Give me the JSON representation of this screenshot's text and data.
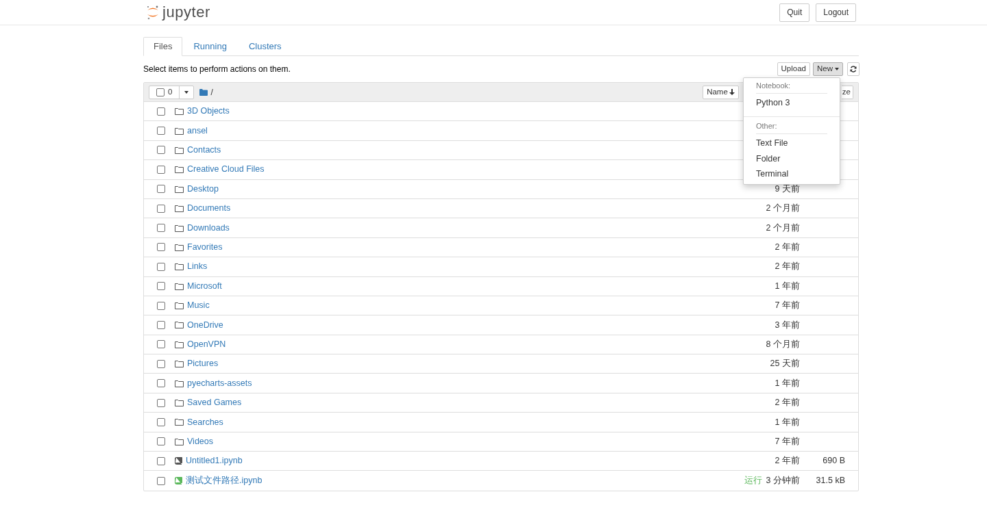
{
  "header": {
    "logo_text": "jupyter",
    "buttons": [
      "Quit",
      "Logout"
    ]
  },
  "tabs": [
    {
      "label": "Files",
      "selected": true
    },
    {
      "label": "Running",
      "selected": false
    },
    {
      "label": "Clusters",
      "selected": false
    }
  ],
  "toolbar": {
    "hint": "Select items to perform actions on them.",
    "buttons": [
      "Upload",
      "New"
    ]
  },
  "list_header": {
    "all_checked": false,
    "selected_count": "0",
    "path": "/",
    "name_column": "Name",
    "size_column": "ze"
  },
  "new_menu": {
    "sections": [
      {
        "heading": "Notebook:",
        "items": [
          "Python 3"
        ]
      },
      {
        "heading": "Other:",
        "items": [
          "Text File",
          "Folder",
          "Terminal"
        ]
      }
    ]
  },
  "rows": [
    {
      "kind": "folder",
      "name": "3D Objects",
      "checked": false
    },
    {
      "kind": "folder",
      "name": "ansel",
      "checked": false
    },
    {
      "kind": "folder",
      "name": "Contacts",
      "checked": false
    },
    {
      "kind": "folder",
      "name": "Creative Cloud Files",
      "checked": false
    },
    {
      "kind": "folder",
      "name": "Desktop",
      "checked": false,
      "modified": "9 天前"
    },
    {
      "kind": "folder",
      "name": "Documents",
      "checked": false,
      "modified": "2 个月前"
    },
    {
      "kind": "folder",
      "name": "Downloads",
      "checked": false,
      "modified": "2 个月前"
    },
    {
      "kind": "folder",
      "name": "Favorites",
      "checked": false,
      "modified": "2 年前"
    },
    {
      "kind": "folder",
      "name": "Links",
      "checked": false,
      "modified": "2 年前"
    },
    {
      "kind": "folder",
      "name": "Microsoft",
      "checked": false,
      "modified": "1 年前"
    },
    {
      "kind": "folder",
      "name": "Music",
      "checked": false,
      "modified": "7 年前"
    },
    {
      "kind": "folder",
      "name": "OneDrive",
      "checked": false,
      "modified": "3 年前"
    },
    {
      "kind": "folder",
      "name": "OpenVPN",
      "checked": false,
      "modified": "8 个月前"
    },
    {
      "kind": "folder",
      "name": "Pictures",
      "checked": false,
      "modified": "25 天前"
    },
    {
      "kind": "folder",
      "name": "pyecharts-assets",
      "checked": false,
      "modified": "1 年前"
    },
    {
      "kind": "folder",
      "name": "Saved Games",
      "checked": false,
      "modified": "2 年前"
    },
    {
      "kind": "folder",
      "name": "Searches",
      "checked": false,
      "modified": "1 年前"
    },
    {
      "kind": "folder",
      "name": "Videos",
      "checked": false,
      "modified": "7 年前"
    },
    {
      "kind": "notebook",
      "name": "Untitled1.ipynb",
      "checked": false,
      "running": false,
      "modified": "2 年前",
      "size": "690 B"
    },
    {
      "kind": "notebook",
      "name": "测试文件路径.ipynb",
      "checked": false,
      "running": true,
      "status": "运行",
      "modified": "3 分钟前",
      "size": "31.5 kB"
    }
  ]
}
